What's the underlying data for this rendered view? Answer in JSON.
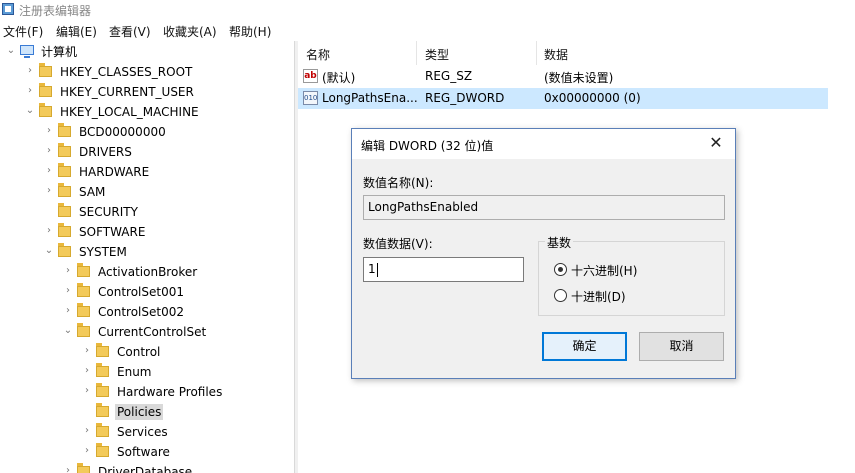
{
  "window": {
    "title": "注册表编辑器"
  },
  "menu": [
    "文件(F)",
    "编辑(E)",
    "查看(V)",
    "收藏夹(A)",
    "帮助(H)"
  ],
  "tree": [
    {
      "label": "计算机",
      "depth": 0,
      "toggle": "down",
      "icon": "computer"
    },
    {
      "label": "HKEY_CLASSES_ROOT",
      "depth": 1,
      "toggle": "right"
    },
    {
      "label": "HKEY_CURRENT_USER",
      "depth": 1,
      "toggle": "right"
    },
    {
      "label": "HKEY_LOCAL_MACHINE",
      "depth": 1,
      "toggle": "down"
    },
    {
      "label": "BCD00000000",
      "depth": 2,
      "toggle": "right"
    },
    {
      "label": "DRIVERS",
      "depth": 2,
      "toggle": "right"
    },
    {
      "label": "HARDWARE",
      "depth": 2,
      "toggle": "right"
    },
    {
      "label": "SAM",
      "depth": 2,
      "toggle": "right"
    },
    {
      "label": "SECURITY",
      "depth": 2,
      "toggle": "none"
    },
    {
      "label": "SOFTWARE",
      "depth": 2,
      "toggle": "right"
    },
    {
      "label": "SYSTEM",
      "depth": 2,
      "toggle": "down"
    },
    {
      "label": "ActivationBroker",
      "depth": 3,
      "toggle": "right"
    },
    {
      "label": "ControlSet001",
      "depth": 3,
      "toggle": "right"
    },
    {
      "label": "ControlSet002",
      "depth": 3,
      "toggle": "right"
    },
    {
      "label": "CurrentControlSet",
      "depth": 3,
      "toggle": "down"
    },
    {
      "label": "Control",
      "depth": 4,
      "toggle": "right"
    },
    {
      "label": "Enum",
      "depth": 4,
      "toggle": "right"
    },
    {
      "label": "Hardware Profiles",
      "depth": 4,
      "toggle": "right"
    },
    {
      "label": "Policies",
      "depth": 4,
      "toggle": "none",
      "selected": true
    },
    {
      "label": "Services",
      "depth": 4,
      "toggle": "right"
    },
    {
      "label": "Software",
      "depth": 4,
      "toggle": "right"
    },
    {
      "label": "DriverDatabase",
      "depth": 3,
      "toggle": "right"
    }
  ],
  "list": {
    "headers": {
      "name": "名称",
      "type": "类型",
      "data": "数据"
    },
    "rows": [
      {
        "name": "(默认)",
        "type": "REG_SZ",
        "data": "(数值未设置)",
        "icon": "ab"
      },
      {
        "name": "LongPathsEna...",
        "type": "REG_DWORD",
        "data": "0x00000000 (0)",
        "icon": "binary",
        "selected": true
      }
    ]
  },
  "dialog": {
    "title": "编辑 DWORD (32 位)值",
    "close_glyph": "✕",
    "value_name_label": "数值名称(N):",
    "value_name": "LongPathsEnabled",
    "value_data_label": "数值数据(V):",
    "value_data": "1",
    "base_label": "基数",
    "hex_label": "十六进制(H)",
    "dec_label": "十进制(D)",
    "base_selected": "hex",
    "ok_label": "确定",
    "cancel_label": "取消"
  }
}
